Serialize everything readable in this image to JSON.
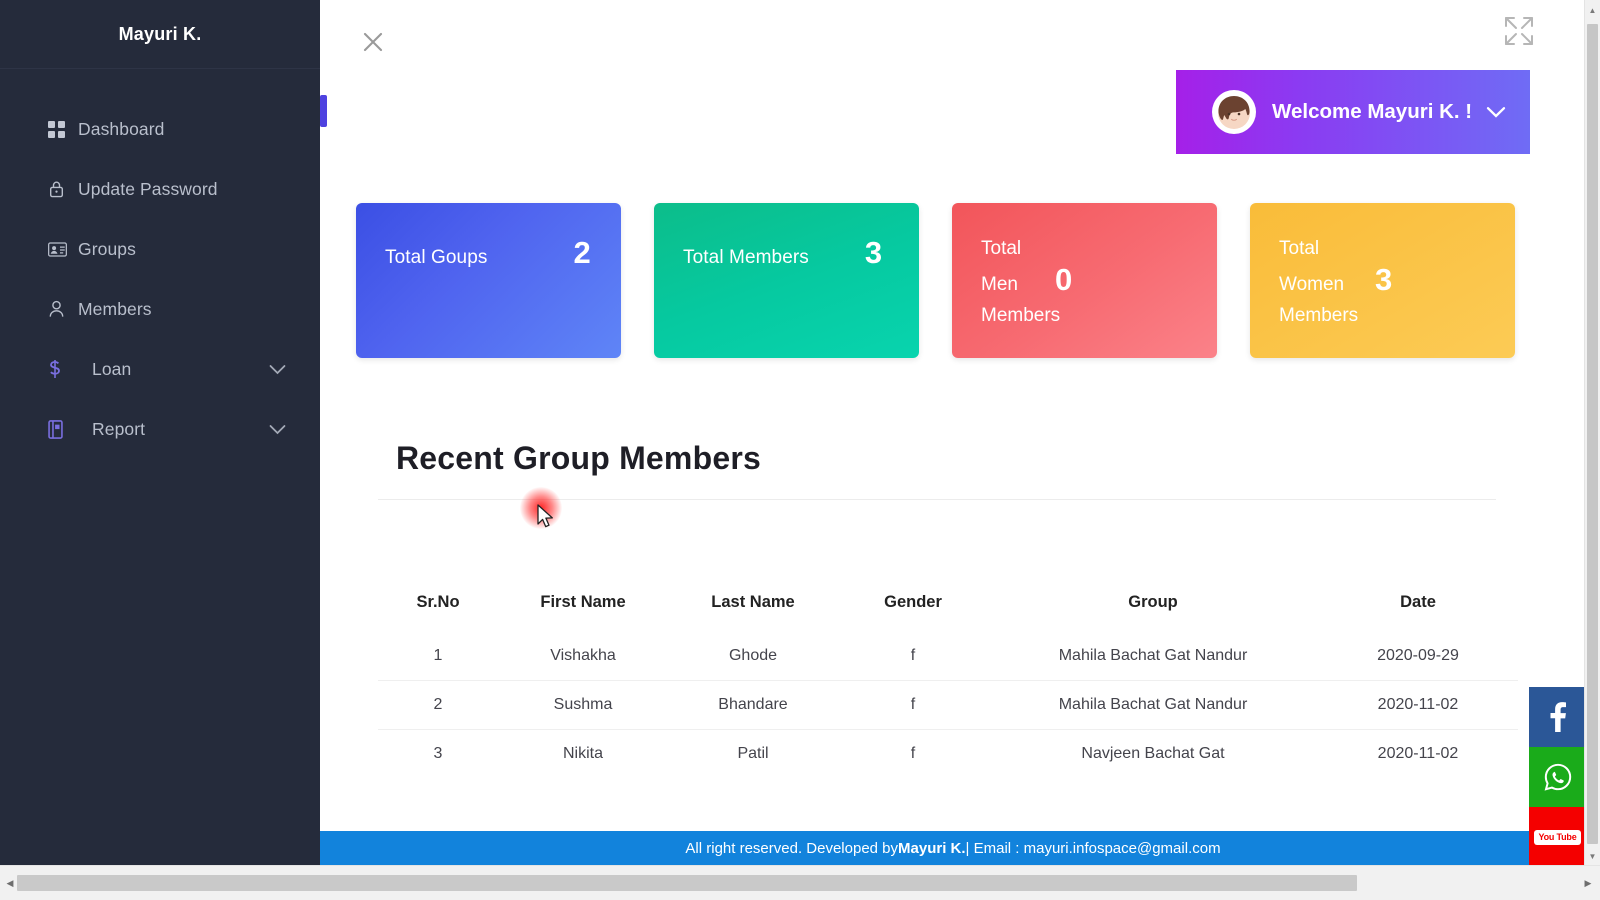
{
  "sidebar": {
    "brand": "Mayuri K.",
    "items": [
      {
        "label": "Dashboard",
        "icon": "grid-icon",
        "has_children": false
      },
      {
        "label": "Update Password",
        "icon": "lock-icon",
        "has_children": false
      },
      {
        "label": "Groups",
        "icon": "id-card-icon",
        "has_children": false
      },
      {
        "label": "Members",
        "icon": "user-icon",
        "has_children": false
      },
      {
        "label": "Loan",
        "icon": "dollar-icon",
        "has_children": true
      },
      {
        "label": "Report",
        "icon": "book-icon",
        "has_children": true
      }
    ]
  },
  "topbar": {
    "close_label": "×",
    "expand_icon": "expand-arrows-icon",
    "welcome_text": "Welcome Mayuri K. !",
    "avatar_icon": "user-avatar",
    "chevron_icon": "chevron-down-icon"
  },
  "cards": [
    {
      "label": "Total Goups",
      "value": "2",
      "color": "#4f63ef"
    },
    {
      "label": "Total Members",
      "value": "3",
      "color": "#06c9a0"
    },
    {
      "label_line1": "Total",
      "label_mid": "Men",
      "value": "0",
      "label_line3": "Members",
      "color": "#f76b72"
    },
    {
      "label_line1": "Total",
      "label_mid": "Women",
      "value": "3",
      "label_line3": "Members",
      "color": "#f9bc39"
    }
  ],
  "section": {
    "title": "Recent Group Members"
  },
  "table": {
    "headers": [
      "Sr.No",
      "First Name",
      "Last Name",
      "Gender",
      "Group",
      "Date"
    ],
    "rows": [
      {
        "srno": "1",
        "first": "Vishakha",
        "last": "Ghode",
        "gender": "f",
        "group": "Mahila Bachat Gat Nandur",
        "date": "2020-09-29"
      },
      {
        "srno": "2",
        "first": "Sushma",
        "last": "Bhandare",
        "gender": "f",
        "group": "Mahila Bachat Gat Nandur",
        "date": "2020-11-02"
      },
      {
        "srno": "3",
        "first": "Nikita",
        "last": "Patil",
        "gender": "f",
        "group": "Navjeen Bachat Gat",
        "date": "2020-11-02"
      }
    ]
  },
  "footer": {
    "prefix": "All right reserved. Developed by ",
    "author": "Mayuri K.",
    "suffix": " | Email : mayuri.infospace@gmail.com"
  },
  "social": [
    {
      "name": "facebook",
      "glyph": "f",
      "color": "#2b5797"
    },
    {
      "name": "whatsapp",
      "glyph": "✆",
      "color": "#1aab1a"
    },
    {
      "name": "youtube",
      "glyph": "You Tube",
      "color": "#f40000"
    }
  ],
  "scrollbars": {
    "up_arrow": "▲",
    "down_arrow": "▼",
    "left_arrow": "◀",
    "right_arrow": "▶"
  }
}
